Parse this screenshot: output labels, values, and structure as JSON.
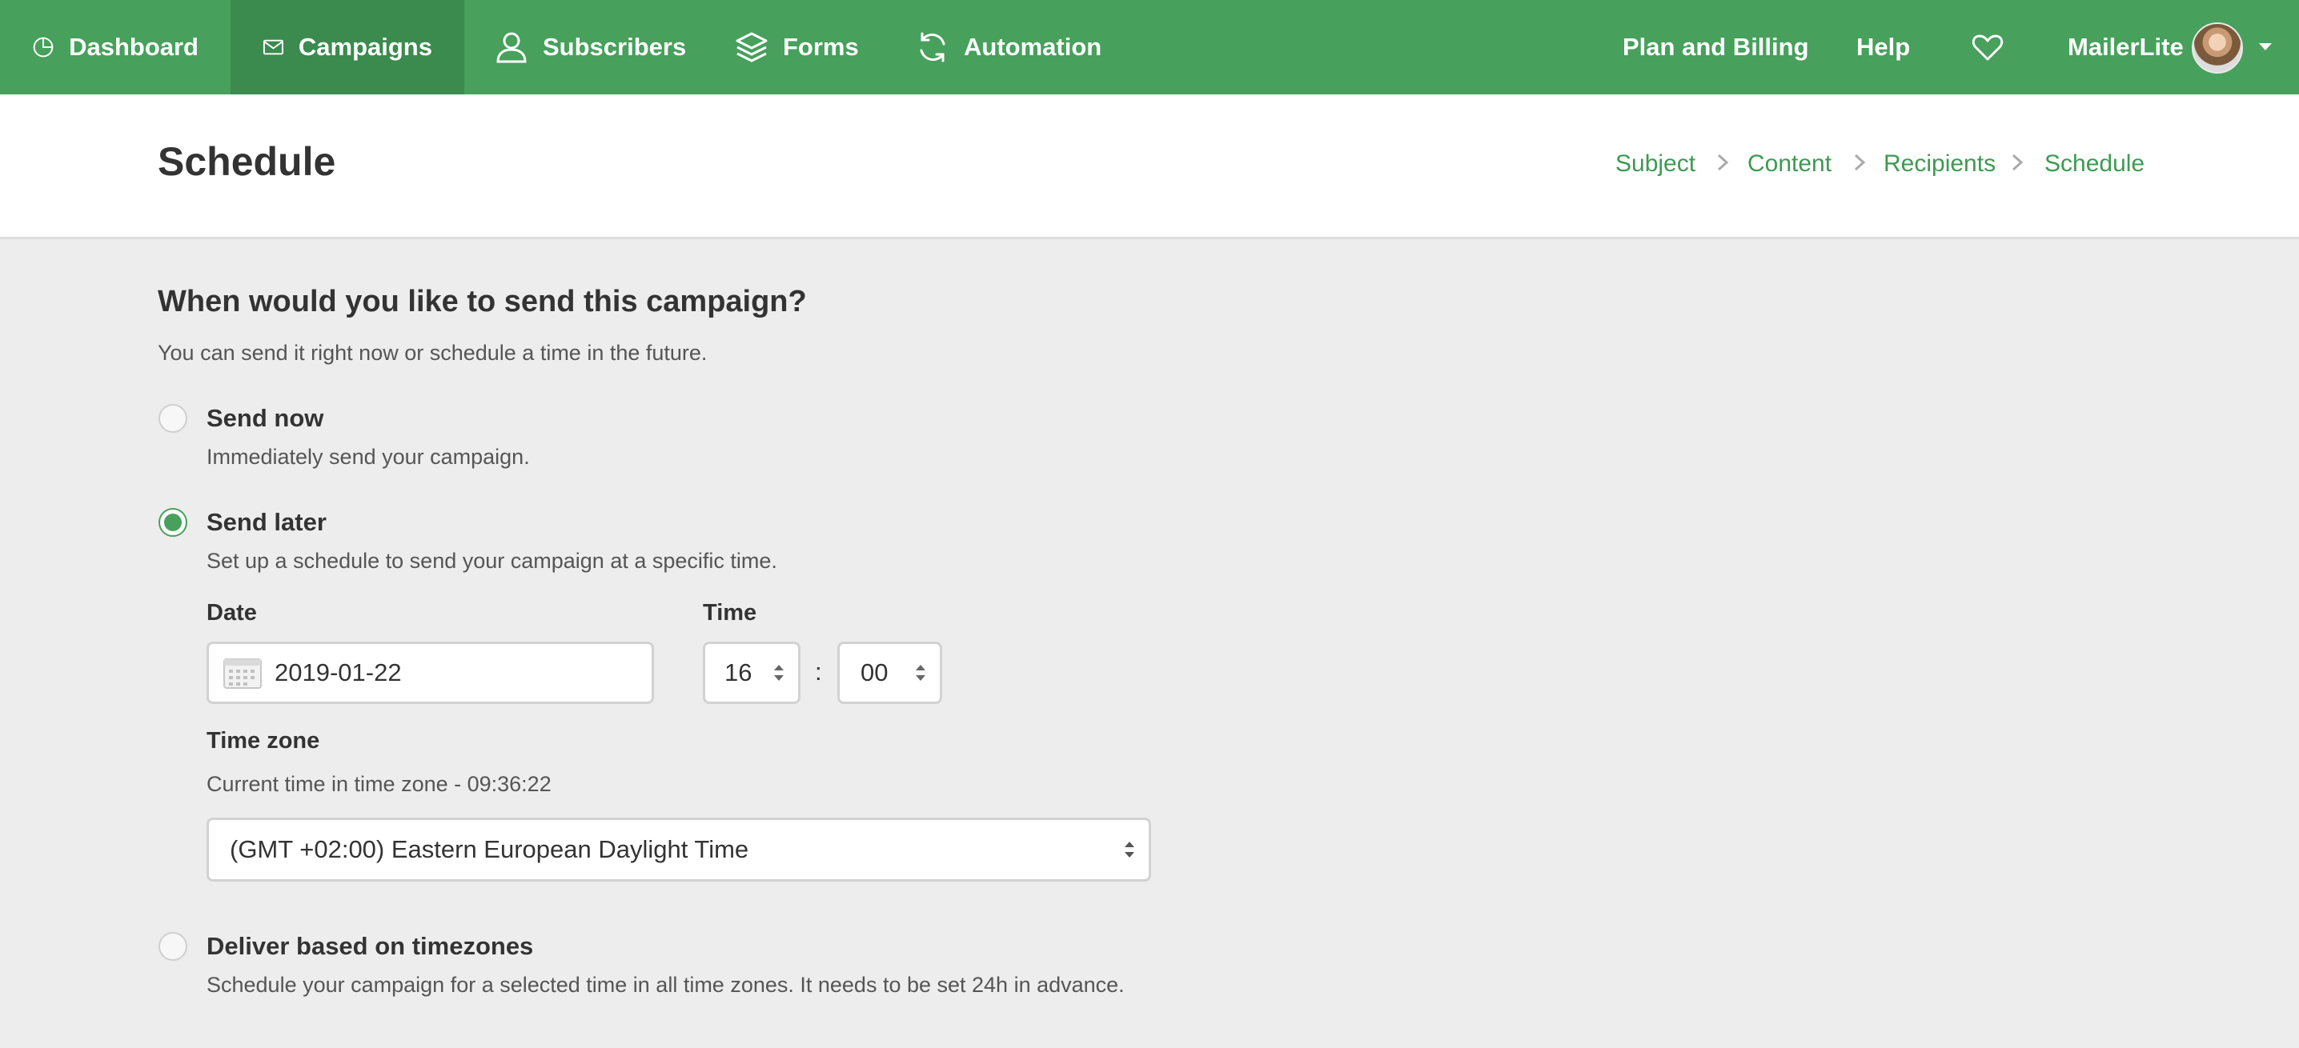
{
  "nav": {
    "items": [
      {
        "label": "Dashboard",
        "icon": "dashboard-icon"
      },
      {
        "label": "Campaigns",
        "icon": "envelope-icon",
        "active": true
      },
      {
        "label": "Subscribers",
        "icon": "user-icon"
      },
      {
        "label": "Forms",
        "icon": "layers-icon"
      },
      {
        "label": "Automation",
        "icon": "refresh-icon"
      }
    ],
    "plan_billing": "Plan and Billing",
    "help": "Help",
    "account_name": "MailerLite",
    "brand_color": "#47a05b"
  },
  "header": {
    "title": "Schedule",
    "breadcrumbs": [
      "Subject",
      "Content",
      "Recipients",
      "Schedule"
    ]
  },
  "schedule": {
    "question": "When would you like to send this campaign?",
    "description": "You can send it right now or schedule a time in the future.",
    "options": {
      "send_now": {
        "label": "Send now",
        "description": "Immediately send your campaign.",
        "checked": false
      },
      "send_later": {
        "label": "Send later",
        "description": "Set up a schedule to send your campaign at a specific time.",
        "checked": true
      },
      "timezones": {
        "label": "Deliver based on timezones",
        "description": "Schedule your campaign for a selected time in all time zones. It needs to be set 24h in advance.",
        "checked": false
      }
    },
    "date_label": "Date",
    "date_value": "2019-01-22",
    "time_label": "Time",
    "hour": "16",
    "separator": ":",
    "minute": "00",
    "timezone_label": "Time zone",
    "current_time_text": "Current time in time zone - 09:36:22",
    "timezone_value": "(GMT +02:00) Eastern European Daylight Time"
  }
}
